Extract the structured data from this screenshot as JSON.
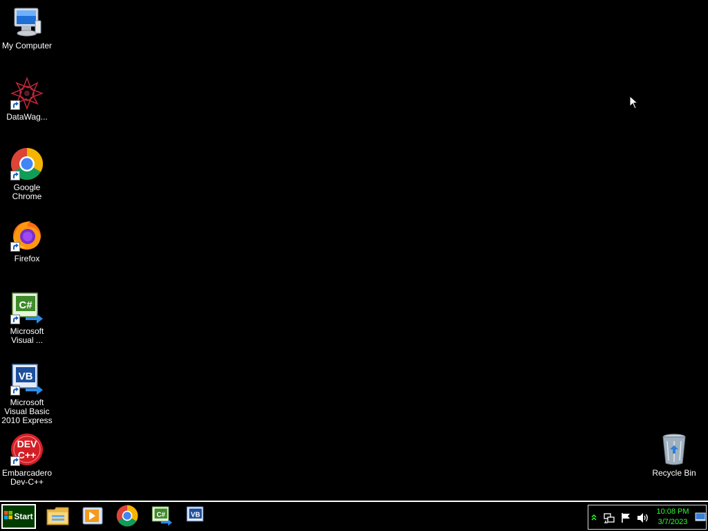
{
  "desktop": {
    "icons": [
      {
        "label": "My Computer",
        "icon": "computer-icon"
      },
      {
        "label": "DataWag...",
        "icon": "datawag-icon"
      },
      {
        "label": "Google Chrome",
        "icon": "chrome-icon"
      },
      {
        "label": "Firefox",
        "icon": "firefox-icon"
      },
      {
        "label": "Microsoft Visual ...",
        "icon": "visual-csharp-icon"
      },
      {
        "label": "Microsoft Visual Basic 2010 Express",
        "icon": "visual-basic-icon"
      },
      {
        "label": "Embarcadero Dev-C++",
        "icon": "devcpp-icon"
      },
      {
        "label": "Recycle Bin",
        "icon": "recycle-bin-icon"
      }
    ]
  },
  "taskbar": {
    "start_label": "Start",
    "pinned": [
      {
        "icon": "file-explorer-icon"
      },
      {
        "icon": "media-player-icon"
      },
      {
        "icon": "chrome-icon"
      },
      {
        "icon": "visual-csharp-icon"
      },
      {
        "icon": "visual-basic-icon"
      }
    ],
    "tray": {
      "icons": [
        "show-hidden-icons-icon",
        "network-icon",
        "action-center-flag-icon",
        "volume-icon"
      ],
      "time": "10:08 PM",
      "date": "3/7/2023"
    }
  },
  "colors": {
    "desktop_bg": "#000000",
    "clock_text": "#2dff2d",
    "taskbar_border": "#ffffff"
  }
}
